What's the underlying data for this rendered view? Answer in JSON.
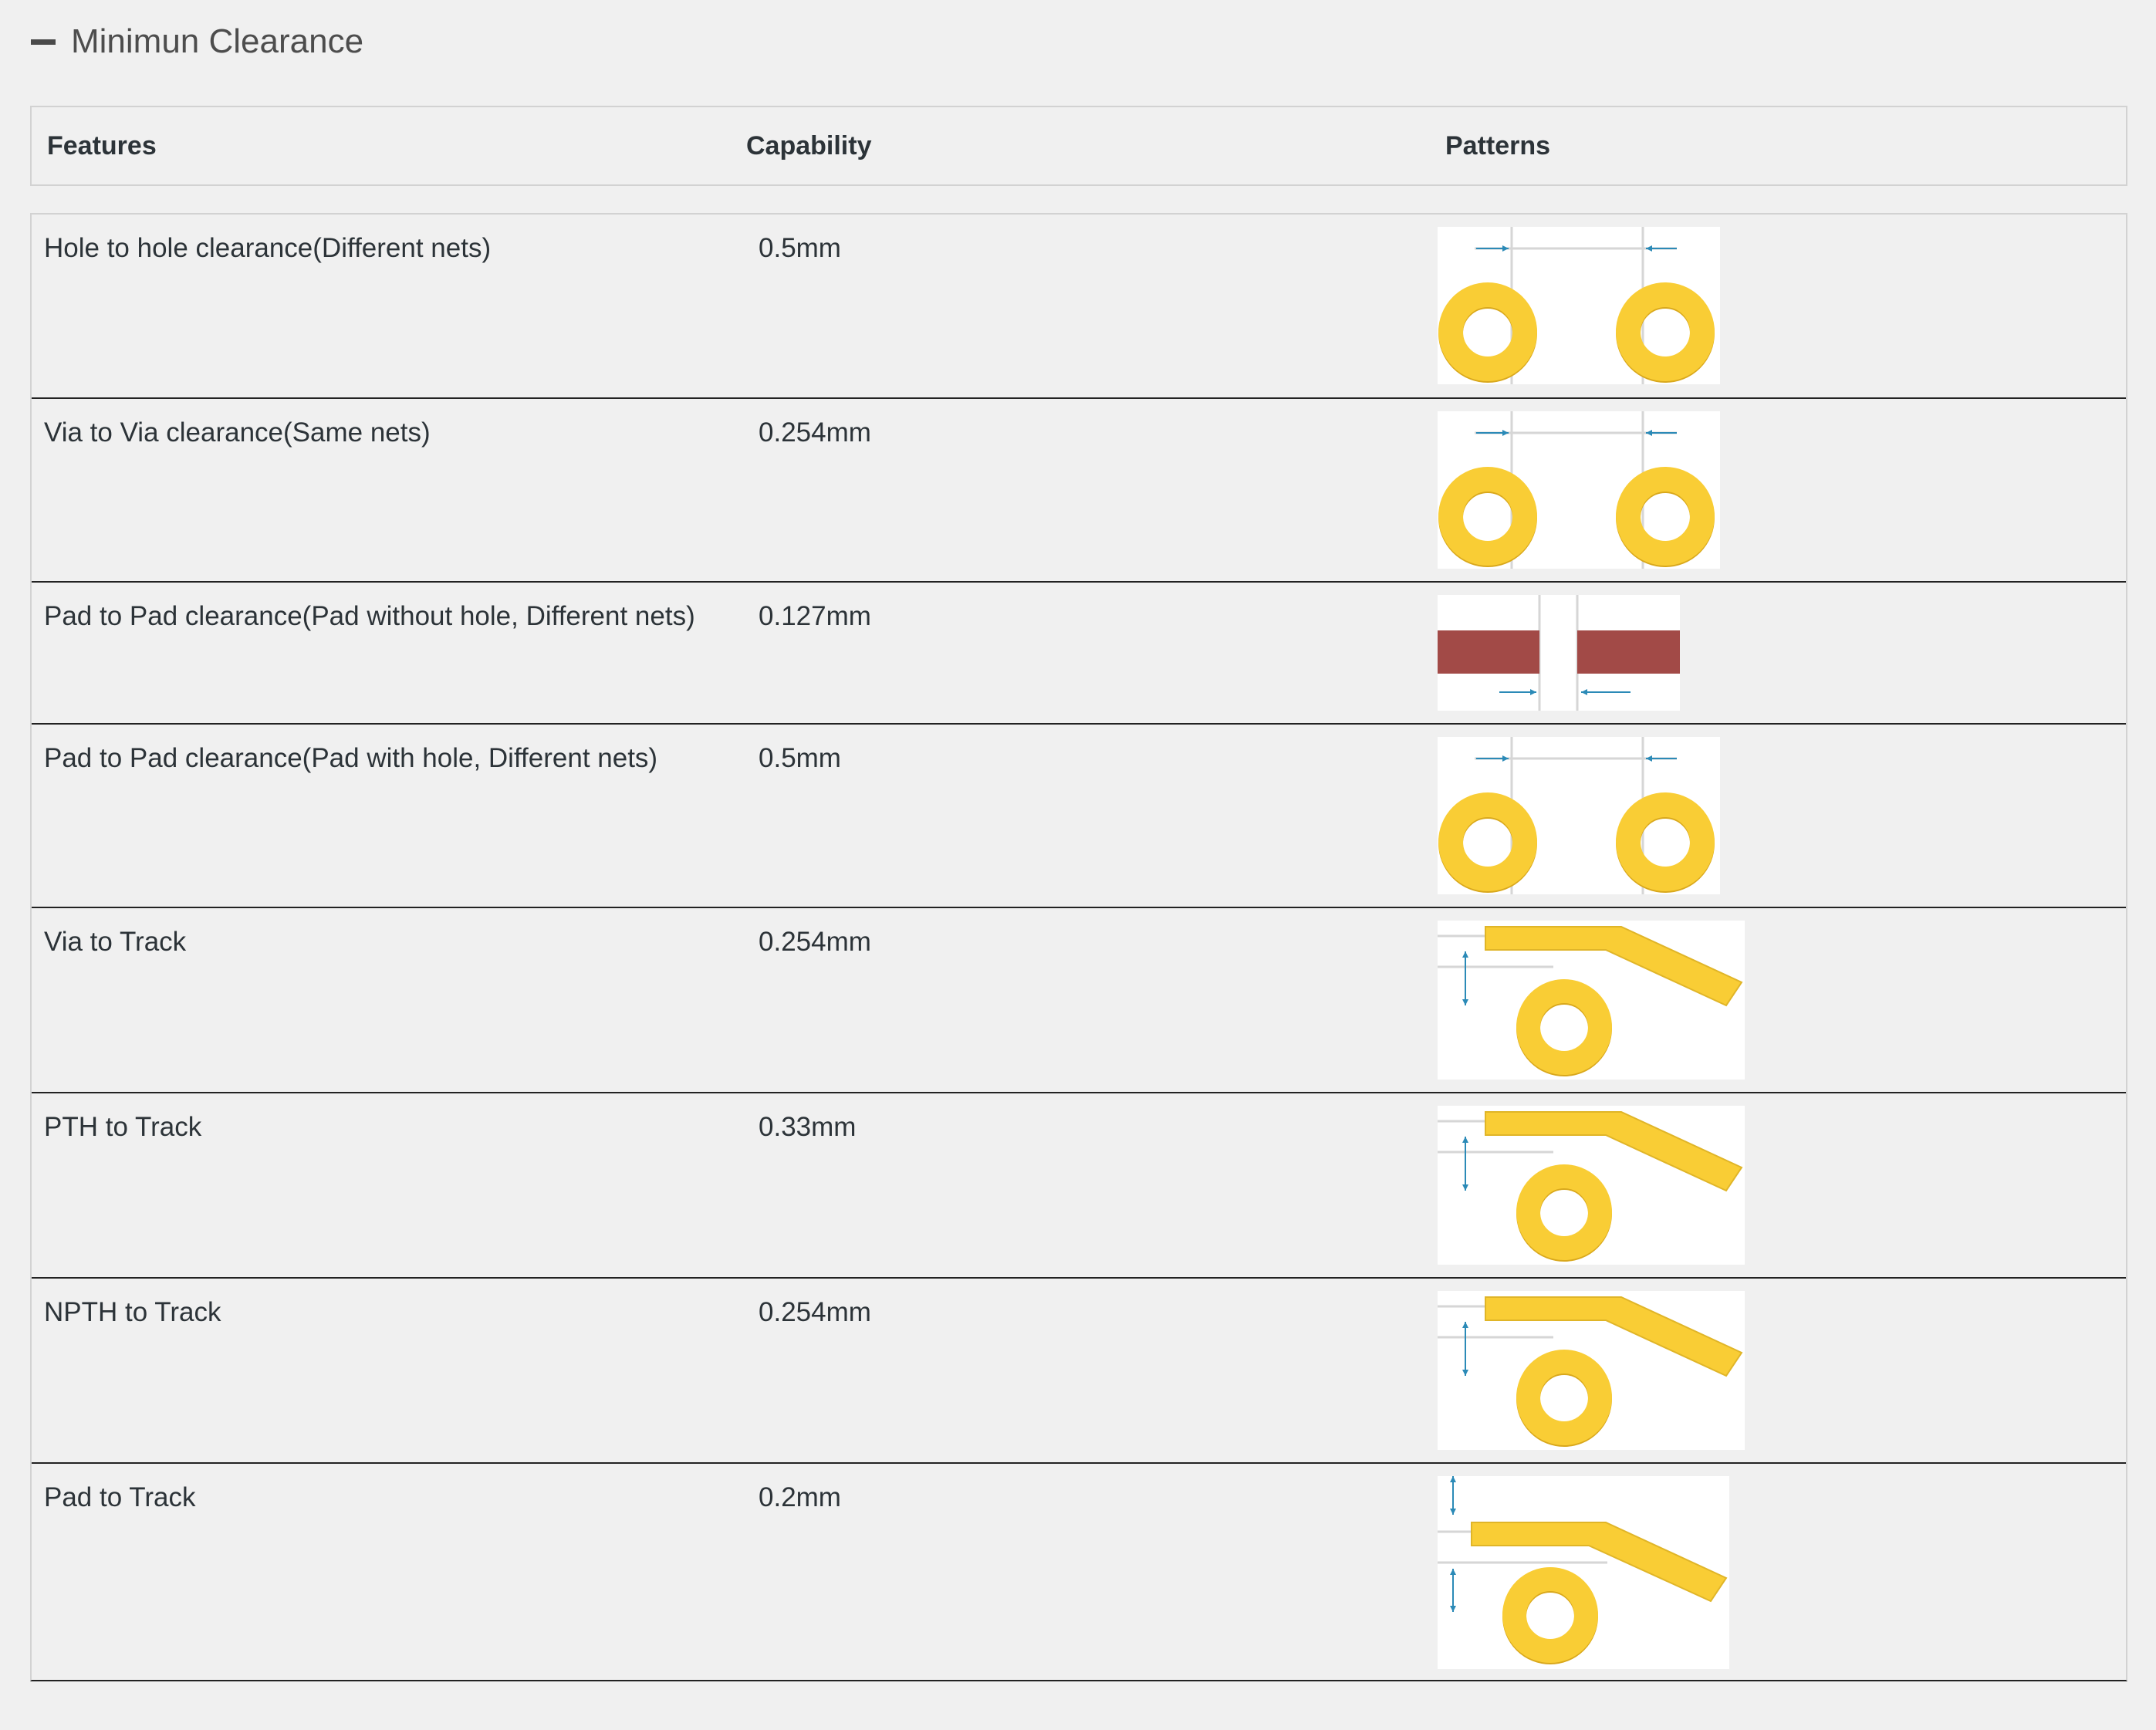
{
  "section": {
    "title": "Minimun Clearance",
    "toggle_icon": "minus-icon"
  },
  "table": {
    "headers": [
      "Features",
      "Capability",
      "Patterns"
    ],
    "rows": [
      {
        "feature": "Hole to hole clearance(Different nets)",
        "capability": "0.5mm",
        "pattern": "two-rings"
      },
      {
        "feature": "Via to Via clearance(Same nets)",
        "capability": "0.254mm",
        "pattern": "two-rings"
      },
      {
        "feature": "Pad to Pad clearance(Pad without hole, Different nets)",
        "capability": "0.127mm",
        "pattern": "two-pads"
      },
      {
        "feature": "Pad to Pad clearance(Pad with hole, Different nets)",
        "capability": "0.5mm",
        "pattern": "two-rings"
      },
      {
        "feature": "Via to Track",
        "capability": "0.254mm",
        "pattern": "ring-track"
      },
      {
        "feature": "PTH to Track",
        "capability": "0.33mm",
        "pattern": "ring-track"
      },
      {
        "feature": "NPTH to Track",
        "capability": "0.254mm",
        "pattern": "ring-track"
      },
      {
        "feature": "Pad to Track",
        "capability": "0.2mm",
        "pattern": "ring-track-tall"
      }
    ]
  },
  "colors": {
    "copper": "#f9cd35",
    "pad": "#a24a47",
    "dimension": "#2b8ab7",
    "guide": "#d6d6d6"
  }
}
